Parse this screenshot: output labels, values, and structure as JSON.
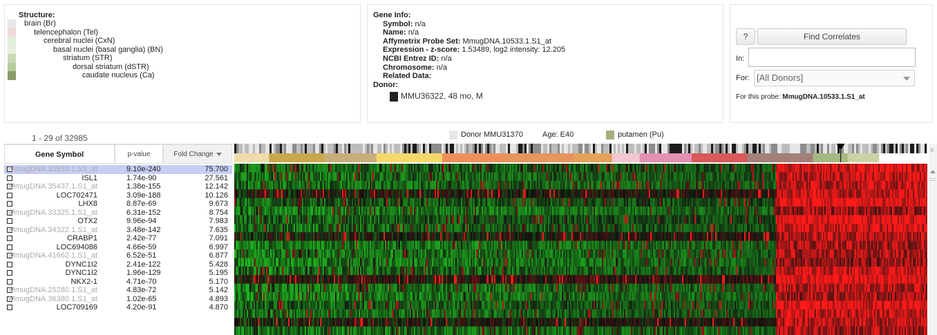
{
  "structure": {
    "title": "Structure:",
    "items": [
      {
        "label": "brain (Br)",
        "color": "#e8e8e8",
        "indent": 0
      },
      {
        "label": "telencephalon (Tel)",
        "color": "#f2d9d9",
        "indent": 1
      },
      {
        "label": "cerebral nuclei (CxN)",
        "color": "#dff0da",
        "indent": 2
      },
      {
        "label": "basal nuclei (basal ganglia) (BN)",
        "color": "#e6efd9",
        "indent": 3
      },
      {
        "label": "striatum (STR)",
        "color": "#cad9b5",
        "indent": 4
      },
      {
        "label": "dorsal striatum (dSTR)",
        "color": "#b8cca0",
        "indent": 5
      },
      {
        "label": "caudate nucleus (Ca)",
        "color": "#8a9e6a",
        "indent": 6
      }
    ]
  },
  "gene_info": {
    "title": "Gene Info:",
    "symbol_label": "Symbol:",
    "symbol_value": "n/a",
    "name_label": "Name:",
    "name_value": "n/a",
    "probe_label": "Affymetrix Probe Set:",
    "probe_value": "MmugDNA.10533.1.S1_at",
    "expr_label": "Expression - z-score:",
    "expr_value": "1.53489, log2 intensity: 12.205",
    "entrez_label": "NCBI Entrez ID:",
    "entrez_value": "n/a",
    "chrom_label": "Chromosome:",
    "chrom_value": "n/a",
    "related_label": "Related Data:",
    "donor_label": "Donor:",
    "donor_value": "MMU36322, 48 mo, M",
    "donor_color": "#222222"
  },
  "correlates": {
    "help_label": "?",
    "find_label": "Find Correlates",
    "in_label": "In:",
    "in_value": "",
    "for_label": "For:",
    "for_value": "[All Donors]",
    "probe_prefix": "For this probe:",
    "probe_value": "MmugDNA.10533.1.S1_at"
  },
  "range_text": "1 - 29 of 32985",
  "hover_legend": {
    "donor": "Donor MMU31370",
    "age": "Age: E40",
    "structure": "putamen (Pu)",
    "donor_color": "#e8e8e8",
    "structure_color": "#a7ae80"
  },
  "table": {
    "col_symbol": "Gene Symbol",
    "col_pvalue": "p-value",
    "col_fold": "Fold Change",
    "rows": [
      {
        "symbol": "MmugDNA.10533.1.S1_at",
        "p": "9.10e-240",
        "fc": "75.700",
        "probe": true,
        "selected": true
      },
      {
        "symbol": "ISL1",
        "p": "1.74e-90",
        "fc": "27.561",
        "probe": false
      },
      {
        "symbol": "MmugDNA.35437.1.S1_at",
        "p": "1.38e-155",
        "fc": "12.142",
        "probe": true
      },
      {
        "symbol": "LOC702471",
        "p": "3.09e-188",
        "fc": "10.126",
        "probe": false
      },
      {
        "symbol": "LHX8",
        "p": "8.87e-69",
        "fc": "9.673",
        "probe": false
      },
      {
        "symbol": "MmugDNA.33325.1.S1_at",
        "p": "6.31e-152",
        "fc": "8.754",
        "probe": true
      },
      {
        "symbol": "OTX2",
        "p": "9.96e-94",
        "fc": "7.983",
        "probe": false
      },
      {
        "symbol": "MmugDNA.34322.1.S1_at",
        "p": "3.48e-142",
        "fc": "7.635",
        "probe": true
      },
      {
        "symbol": "CRABP1",
        "p": "2.42e-77",
        "fc": "7.091",
        "probe": false
      },
      {
        "symbol": "LOC694086",
        "p": "4.66e-59",
        "fc": "6.997",
        "probe": false
      },
      {
        "symbol": "MmugDNA.41662.1.S1_at",
        "p": "6.52e-51",
        "fc": "6.877",
        "probe": true
      },
      {
        "symbol": "DYNC1I2",
        "p": "2.41e-122",
        "fc": "5.428",
        "probe": false
      },
      {
        "symbol": "DYNC1I2",
        "p": "1.96e-129",
        "fc": "5.195",
        "probe": false
      },
      {
        "symbol": "NKX2-1",
        "p": "4.71e-70",
        "fc": "5.170",
        "probe": false
      },
      {
        "symbol": "MmugDNA.25280.1.S1_at",
        "p": "4.83e-72",
        "fc": "5.142",
        "probe": true
      },
      {
        "symbol": "MmugDNA.36380.1.S1_at",
        "p": "1.02e-65",
        "fc": "4.893",
        "probe": true
      },
      {
        "symbol": "LOC709169",
        "p": "4.20e-91",
        "fc": "4.870",
        "probe": false
      }
    ]
  },
  "heatmap": {
    "structure_bands": [
      {
        "color": "#efdcaa",
        "frac": 0.05
      },
      {
        "color": "#c9a84b",
        "frac": 0.08
      },
      {
        "color": "#c7ad7c",
        "frac": 0.075
      },
      {
        "color": "#f6d86a",
        "frac": 0.095
      },
      {
        "color": "#ee8f5a",
        "frac": 0.09
      },
      {
        "color": "#e8945e",
        "frac": 0.1
      },
      {
        "color": "#e5a258",
        "frac": 0.055
      },
      {
        "color": "#f1c7d0",
        "frac": 0.04
      },
      {
        "color": "#e58fb3",
        "frac": 0.075
      },
      {
        "color": "#d95858",
        "frac": 0.08
      },
      {
        "color": "#a37f77",
        "frac": 0.095
      },
      {
        "color": "#a5b87f",
        "frac": 0.05
      },
      {
        "color": "#c9d3a7",
        "frac": 0.045
      }
    ],
    "high_region_start": 0.78,
    "marker_position": 0.875,
    "colors": {
      "low": "#1fbb1f",
      "mid": "#111111",
      "high": "#ff1a1a"
    }
  }
}
